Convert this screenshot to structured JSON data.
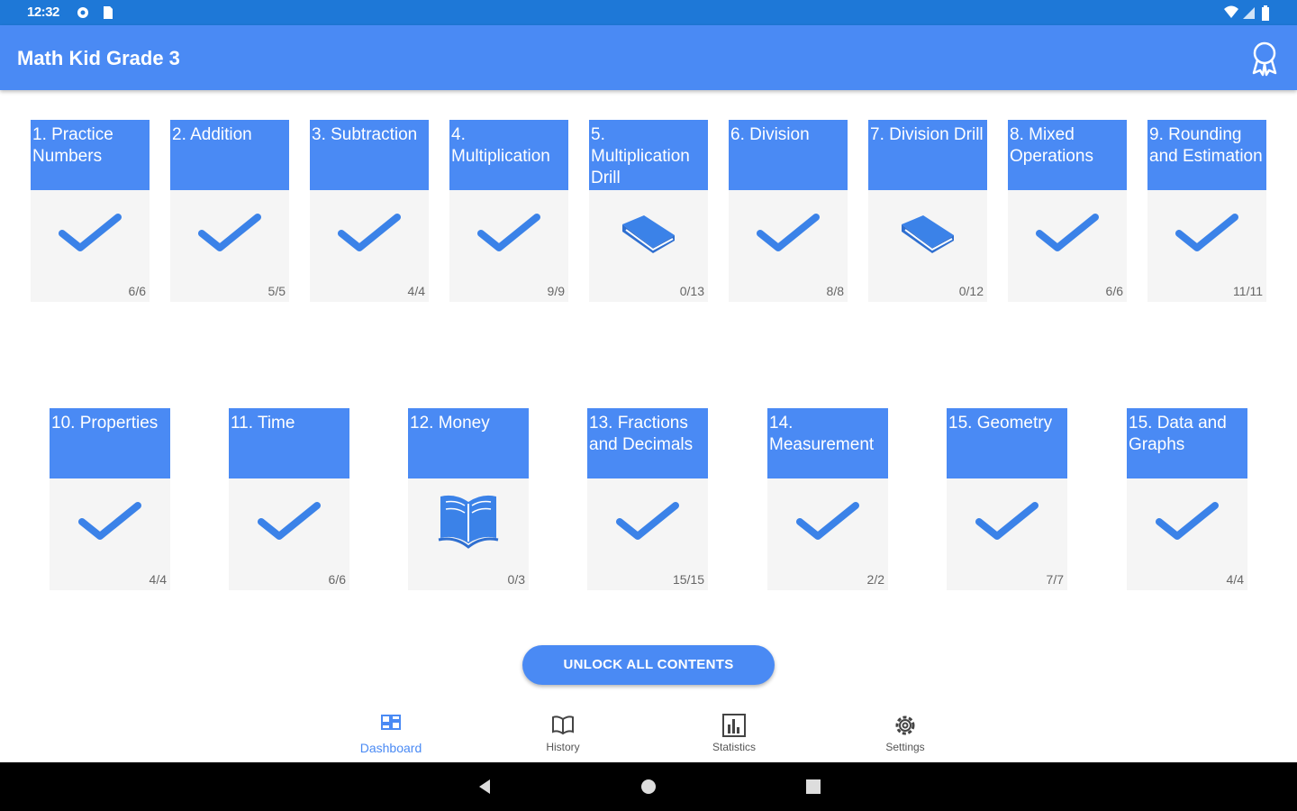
{
  "status_bar": {
    "time": "12:32"
  },
  "app_bar": {
    "title": "Math Kid Grade 3"
  },
  "row1": [
    {
      "title": "1. Practice Numbers",
      "icon": "check-icon",
      "progress": "6/6"
    },
    {
      "title": "2. Addition",
      "icon": "check-icon",
      "progress": "5/5"
    },
    {
      "title": "3. Subtraction",
      "icon": "check-icon",
      "progress": "4/4"
    },
    {
      "title": "4. Multiplication",
      "icon": "check-icon",
      "progress": "9/9"
    },
    {
      "title": "5. Multiplication Drill",
      "icon": "closed-book-icon",
      "progress": "0/13"
    },
    {
      "title": "6. Division",
      "icon": "check-icon",
      "progress": "8/8"
    },
    {
      "title": "7. Division Drill",
      "icon": "closed-book-icon",
      "progress": "0/12"
    },
    {
      "title": "8. Mixed Operations",
      "icon": "check-icon",
      "progress": "6/6"
    },
    {
      "title": "9. Rounding and Estimation",
      "icon": "check-icon",
      "progress": "11/11"
    }
  ],
  "row2": [
    {
      "title": "10. Properties",
      "icon": "check-icon",
      "progress": "4/4"
    },
    {
      "title": "11. Time",
      "icon": "check-icon",
      "progress": "6/6"
    },
    {
      "title": "12. Money",
      "icon": "open-book-icon",
      "progress": "0/3"
    },
    {
      "title": "13. Fractions and Decimals",
      "icon": "check-icon",
      "progress": "15/15"
    },
    {
      "title": "14. Measurement",
      "icon": "check-icon",
      "progress": "2/2"
    },
    {
      "title": "15. Geometry",
      "icon": "check-icon",
      "progress": "7/7"
    },
    {
      "title": "15. Data and Graphs",
      "icon": "check-icon",
      "progress": "4/4"
    }
  ],
  "unlock_button": {
    "label": "UNLOCK ALL CONTENTS"
  },
  "bottom_nav": {
    "items": [
      {
        "label": "Dashboard",
        "icon": "dashboard-icon",
        "active": true
      },
      {
        "label": "History",
        "icon": "history-icon",
        "active": false
      },
      {
        "label": "Statistics",
        "icon": "statistics-icon",
        "active": false
      },
      {
        "label": "Settings",
        "icon": "settings-icon",
        "active": false
      }
    ]
  },
  "colors": {
    "accent": "#4a8af4",
    "status_bar": "#1e78d7",
    "card_bg": "#f5f5f5"
  }
}
